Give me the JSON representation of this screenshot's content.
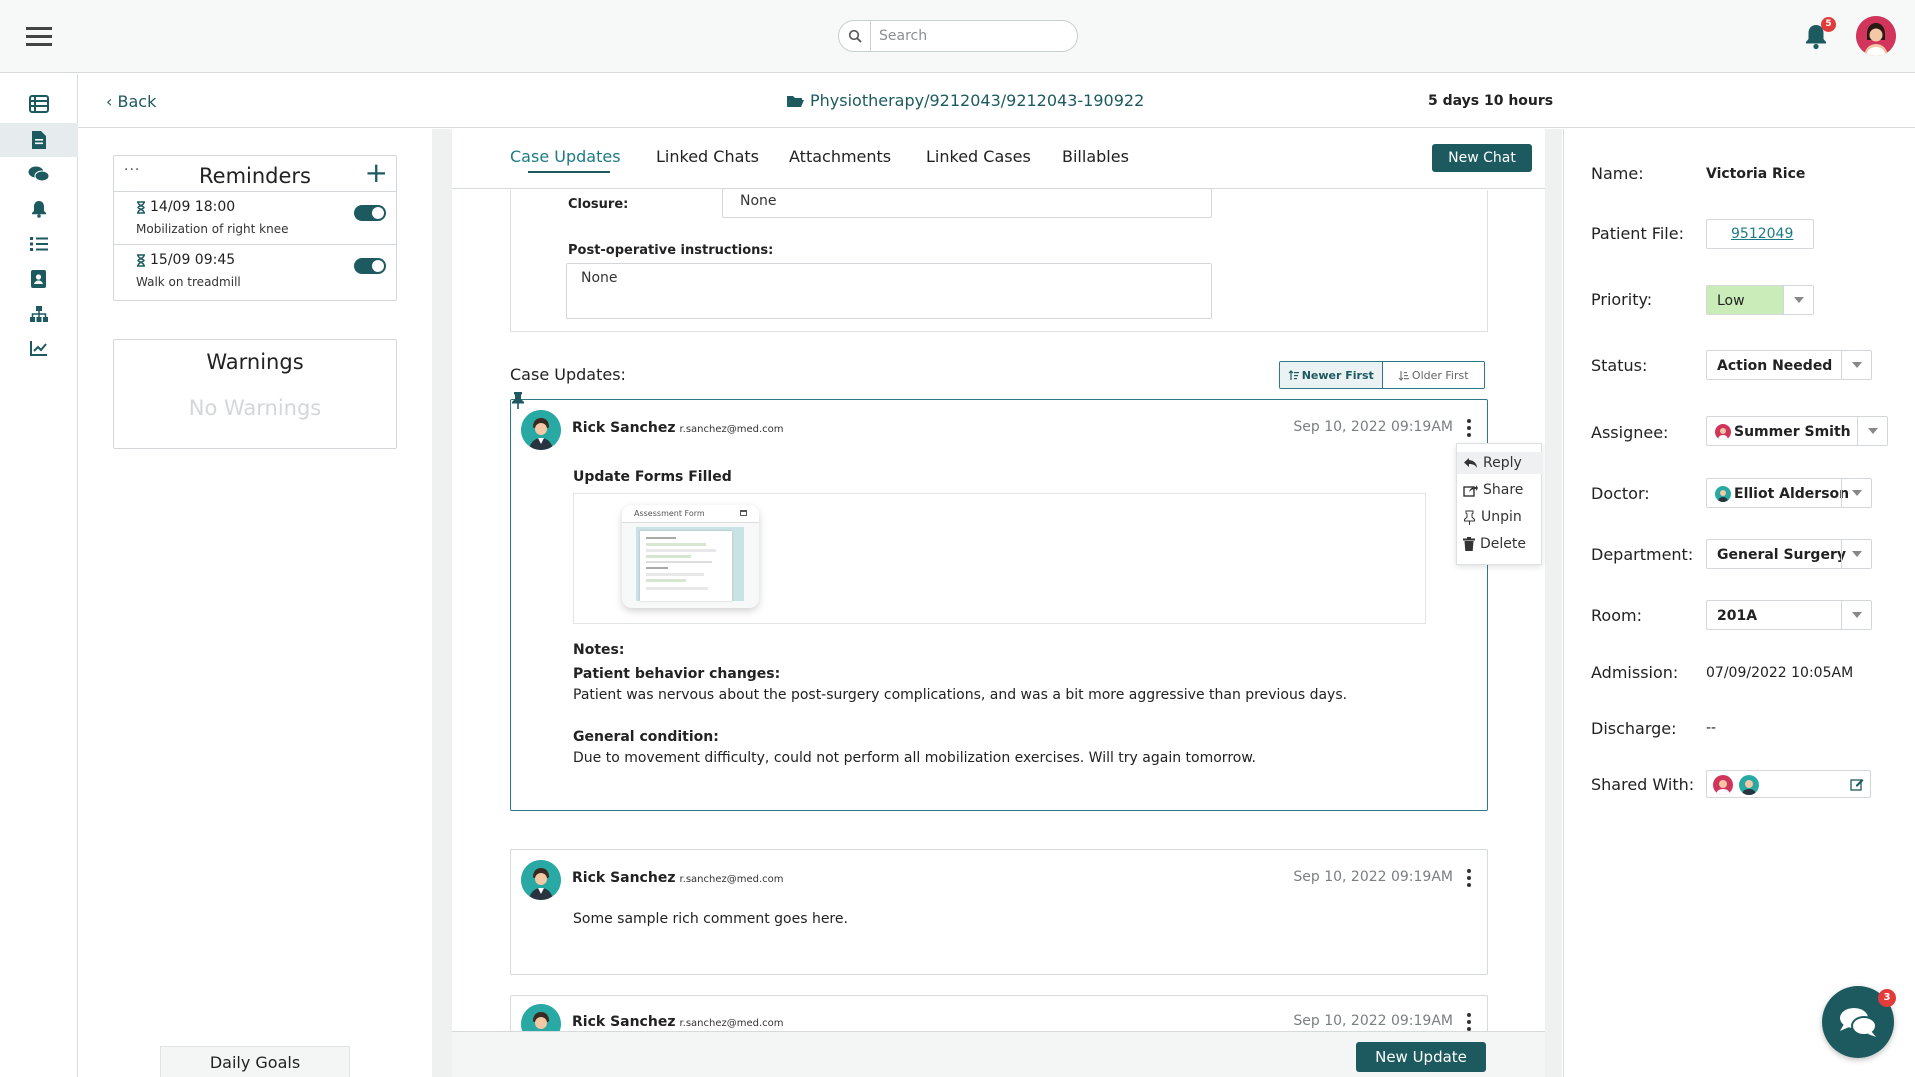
{
  "search": {
    "placeholder": "Search"
  },
  "notifications": {
    "count": "5"
  },
  "subheader": {
    "back_label": "Back",
    "path": "Physiotherapy/9212043/9212043-190922",
    "duration": "5 days 10 hours"
  },
  "reminders": {
    "title": "Reminders",
    "menu": "···",
    "add": "+",
    "items": [
      {
        "time": "14/09 18:00",
        "desc": "Mobilization of right knee",
        "enabled": true
      },
      {
        "time": "15/09 09:45",
        "desc": "Walk on treadmill",
        "enabled": true
      }
    ]
  },
  "warnings": {
    "title": "Warnings",
    "empty": "No Warnings"
  },
  "daily_goals": {
    "label": "Daily Goals"
  },
  "tabs": [
    {
      "label": "Case Updates",
      "active": true
    },
    {
      "label": "Linked Chats",
      "active": false
    },
    {
      "label": "Attachments",
      "active": false
    },
    {
      "label": "Linked Cases",
      "active": false
    },
    {
      "label": "Billables",
      "active": false
    }
  ],
  "new_chat_label": "New Chat",
  "form": {
    "closure_label": "Closure:",
    "closure_value": "None",
    "postop_label": "Post-operative instructions:",
    "postop_value": "None"
  },
  "case_updates": {
    "title": "Case Updates:",
    "sort_newer": "Newer First",
    "sort_older": "Older First",
    "context_menu": [
      "Reply",
      "Share",
      "Unpin",
      "Delete"
    ],
    "items": [
      {
        "author": "Rick Sanchez",
        "email": "r.sanchez@med.com",
        "date": "Sep 10, 2022 09:19AM",
        "pinned": true,
        "forms_title": "Update Forms Filled",
        "form_card": "Assessment Form",
        "notes_label": "Notes:",
        "behavior_label": "Patient behavior changes:",
        "behavior_text": "Patient was nervous about the post-surgery complications, and was a bit more aggressive than previous days.",
        "condition_label": "General condition:",
        "condition_text": "Due to movement difficulty, could not perform all mobilization exercises. Will try again tomorrow."
      },
      {
        "author": "Rick Sanchez",
        "email": "r.sanchez@med.com",
        "date": "Sep 10, 2022 09:19AM",
        "text": "Some sample rich comment goes here."
      },
      {
        "author": "Rick Sanchez",
        "email": "r.sanchez@med.com",
        "date": "Sep 10, 2022 09:19AM"
      }
    ]
  },
  "new_update_label": "New Update",
  "patient": {
    "name_label": "Name:",
    "name": "Victoria Rice",
    "file_label": "Patient File:",
    "file": "9512049",
    "priority_label": "Priority:",
    "priority": "Low",
    "status_label": "Status:",
    "status": "Action Needed",
    "assignee_label": "Assignee:",
    "assignee": "Summer Smith",
    "doctor_label": "Doctor:",
    "doctor": "Elliot Alderson",
    "department_label": "Department:",
    "department": "General Surgery",
    "room_label": "Room:",
    "room": "201A",
    "admission_label": "Admission:",
    "admission": "07/09/2022 10:05AM",
    "discharge_label": "Discharge:",
    "discharge": "--",
    "shared_label": "Shared With:"
  },
  "chat": {
    "count": "3"
  },
  "colors": {
    "primary": "#1d5a60",
    "accent_link": "#1d7a85",
    "badge": "#e23b3b",
    "priority_low": "#c9ecb8"
  }
}
